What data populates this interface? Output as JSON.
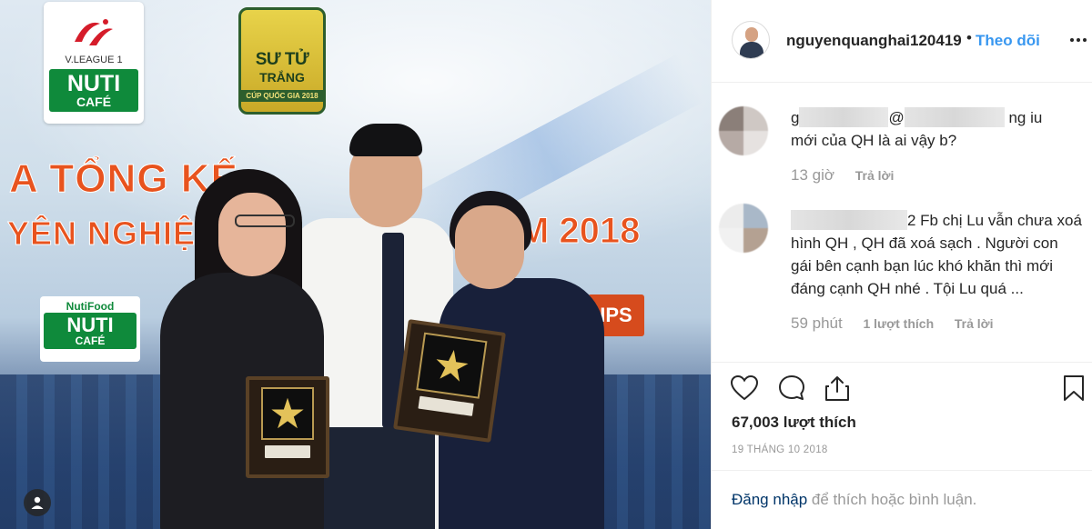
{
  "post": {
    "username": "nguyenquanghai120419",
    "dot": "•",
    "follow_label": "Theo dõi",
    "likes": "67,003 lượt thích",
    "date": "19 THÁNG 10 2018",
    "login_link": "Đăng nhập",
    "login_rest": " để thích hoặc bình luận."
  },
  "photo": {
    "vleague_text": "V.LEAGUE 1",
    "nuti": "NUTI",
    "cafe": "CAFÉ",
    "nutifood": "NutiFood",
    "sutu_line1": "SƯ TỬ",
    "sutu_line2": "TRẮNG",
    "sutu_line3": "CÚP QUỐC GIA 2018",
    "banner_line1": "A TỔNG KẾ",
    "banner_line2": "YÊN NGHIỆ",
    "banner_year": "M 2018",
    "sponsor": "IPS"
  },
  "comments": [
    {
      "text_a": "g",
      "text_b": "@",
      "text_c": "ng iu",
      "text_d": "mới của QH là ai vậy b?",
      "time": "13 giờ",
      "reply": "Trả lời",
      "avatar_colors": [
        "#8b7f79",
        "#cfc8c4",
        "#b6aaa5",
        "#e6e2e0"
      ]
    },
    {
      "text_a": "2 Fb chị Lu vẫn chưa",
      "text_b": "xoá hình QH , QH đã xoá sạch . Người con gái bên cạnh bạn lúc khó khăn thì mới đáng cạnh QH nhé . Tội Lu quá ...",
      "time": "59 phút",
      "likes": "1 lượt thích",
      "reply": "Trả lời",
      "avatar_colors": [
        "#ececec",
        "#a9b8c8",
        "#f1f1f1",
        "#b4a192"
      ]
    }
  ],
  "colors": {
    "link_blue": "#3897f0",
    "muted": "#999999",
    "text": "#262626",
    "login_link": "#003569"
  }
}
